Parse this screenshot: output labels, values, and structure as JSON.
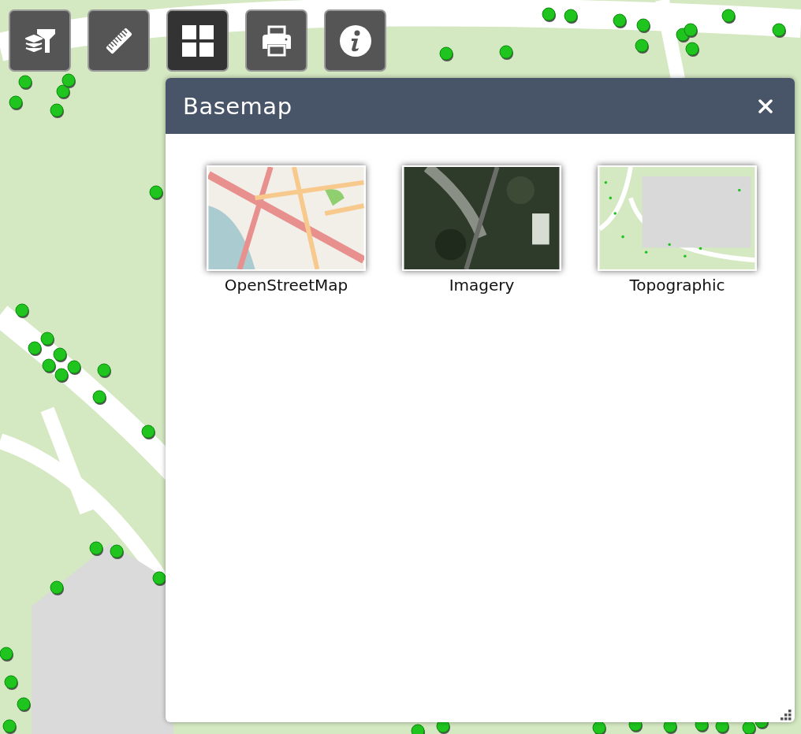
{
  "toolbar": [
    {
      "kind": "filter",
      "selected": false
    },
    {
      "kind": "measure",
      "selected": false
    },
    {
      "kind": "basemap",
      "selected": true
    },
    {
      "kind": "print",
      "selected": false
    },
    {
      "kind": "info",
      "selected": false
    }
  ],
  "panel": {
    "title": "Basemap",
    "basemaps": [
      {
        "label": "OpenStreetMap",
        "kind": "streets"
      },
      {
        "label": "Imagery",
        "kind": "imagery"
      },
      {
        "label": "Topographic",
        "kind": "topo"
      }
    ]
  }
}
